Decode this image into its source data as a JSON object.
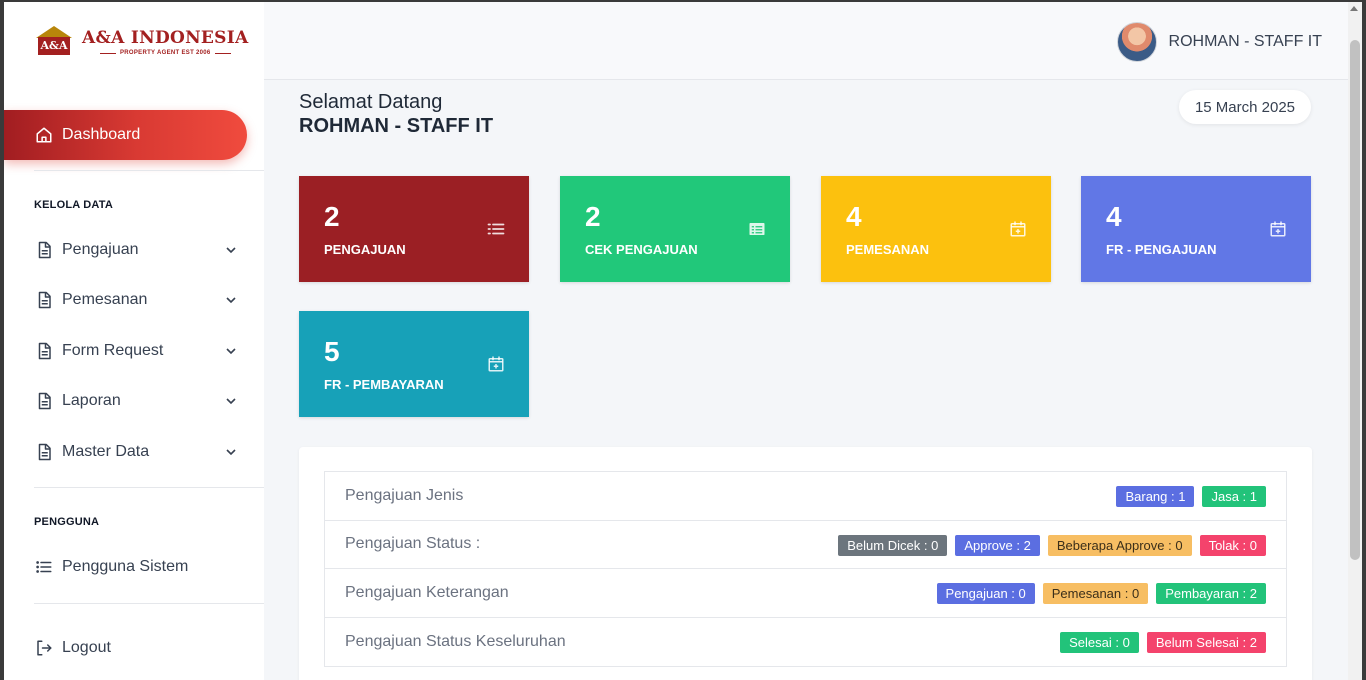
{
  "brand": {
    "badge_text": "A&A",
    "title": "A&A INDONESIA",
    "subtitle": "PROPERTY AGENT EST 2006"
  },
  "sidebar": {
    "active_item": {
      "label": "Dashboard",
      "icon": "home-icon"
    },
    "sections": [
      {
        "label": "KELOLA DATA",
        "items": [
          {
            "label": "Pengajuan",
            "icon": "document-icon"
          },
          {
            "label": "Pemesanan",
            "icon": "document-icon"
          },
          {
            "label": "Form Request",
            "icon": "document-icon"
          },
          {
            "label": "Laporan",
            "icon": "document-icon"
          },
          {
            "label": "Master Data",
            "icon": "document-icon"
          }
        ]
      },
      {
        "label": "PENGGUNA",
        "items": [
          {
            "label": "Pengguna Sistem",
            "icon": "list-icon"
          }
        ]
      }
    ],
    "logout_label": "Logout"
  },
  "header": {
    "user_name": "ROHMAN - STAFF IT"
  },
  "main": {
    "greeting": "Selamat Datang",
    "user_name": "ROHMAN - STAFF IT",
    "date": "15 March 2025",
    "cards": [
      {
        "value": "2",
        "label": "PENGAJUAN",
        "color": "#9b1f24",
        "icon": "list-icon"
      },
      {
        "value": "2",
        "label": "CEK PENGAJUAN",
        "color": "#21c87a",
        "icon": "table-icon"
      },
      {
        "value": "4",
        "label": "PEMESANAN",
        "color": "#fcc10e",
        "icon": "calendar-plus-icon"
      },
      {
        "value": "4",
        "label": "FR - PENGAJUAN",
        "color": "#6177e6",
        "icon": "calendar-plus-icon"
      },
      {
        "value": "5",
        "label": "FR - PEMBAYARAN",
        "color": "#17a1b8",
        "icon": "calendar-plus-icon"
      }
    ],
    "summary": [
      {
        "label": "Pengajuan Jenis",
        "badges": [
          {
            "text": "Barang : 1",
            "color": "#5b6ee1"
          },
          {
            "text": "Jasa : 1",
            "color": "#22c37a"
          }
        ]
      },
      {
        "label": "Pengajuan Status :",
        "badges": [
          {
            "text": "Belum Dicek : 0",
            "color": "#6c757d"
          },
          {
            "text": "Approve : 2",
            "color": "#5b6ee1"
          },
          {
            "text": "Beberapa Approve : 0",
            "color": "#f7be63"
          },
          {
            "text": "Tolak : 0",
            "color": "#f4436c"
          }
        ]
      },
      {
        "label": "Pengajuan Keterangan",
        "badges": [
          {
            "text": "Pengajuan : 0",
            "color": "#5b6ee1"
          },
          {
            "text": "Pemesanan : 0",
            "color": "#f7be63"
          },
          {
            "text": "Pembayaran : 2",
            "color": "#22c37a"
          }
        ]
      },
      {
        "label": "Pengajuan Status Keseluruhan",
        "badges": [
          {
            "text": "Selesai : 0",
            "color": "#22c37a"
          },
          {
            "text": "Belum Selesai : 2",
            "color": "#f4436c"
          }
        ]
      }
    ]
  }
}
